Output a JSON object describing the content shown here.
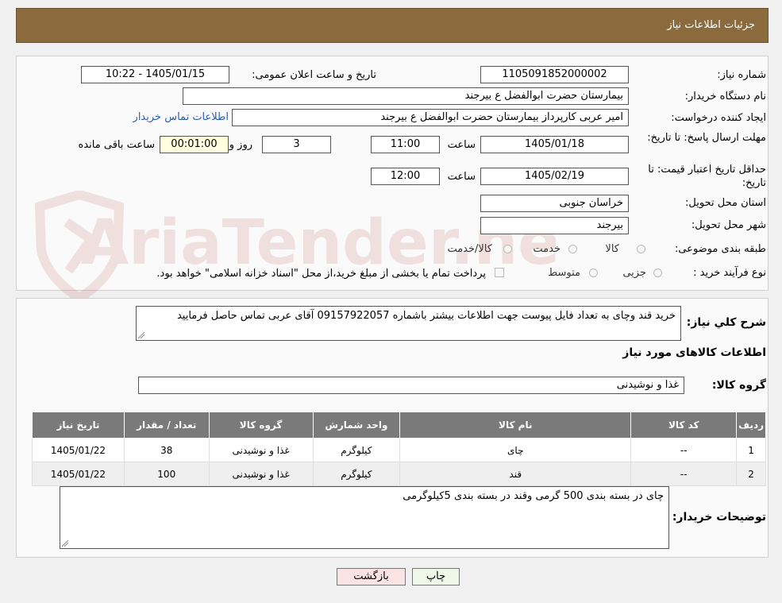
{
  "header": {
    "title": "جزئیات اطلاعات نیاز"
  },
  "form": {
    "need_number_label": "شماره نیاز:",
    "need_number": "1105091852000002",
    "announce_label": "تاریخ و ساعت اعلان عمومی:",
    "announce_value": "1405/01/15 - 10:22",
    "buyer_org_label": "نام دستگاه خریدار:",
    "buyer_org": "بیمارستان حضرت ابوالفضل  ع  بیرجند",
    "creator_label": "ایجاد کننده درخواست:",
    "creator": "امیر عربی کارپرداز بیمارستان حضرت ابوالفضل  ع  بیرجند",
    "contact_link": "اطلاعات تماس خریدار",
    "deadline_label": "مهلت ارسال پاسخ: تا تاریخ:",
    "deadline_date": "1405/01/18",
    "time_label": "ساعت",
    "deadline_time": "11:00",
    "days_value": "3",
    "days_label": "روز و",
    "remaining_time": "00:01:00",
    "remaining_label": "ساعت باقی مانده",
    "validity_label": "حداقل تاریخ اعتبار قیمت: تا تاریخ:",
    "validity_date": "1405/02/19",
    "validity_time": "12:00",
    "province_label": "استان محل تحویل:",
    "province": "خراسان جنوبی",
    "city_label": "شهر محل تحویل:",
    "city": "بیرجند",
    "category_label": "طبقه بندی موضوعی:",
    "category_options": [
      "کالا",
      "خدمت",
      "کالا/خدمت"
    ],
    "process_label": "نوع فرآیند خرید :",
    "process_options": [
      "جزیی",
      "متوسط"
    ],
    "payment_note": "پرداخت تمام یا بخشی از مبلغ خرید،از محل \"اسناد خزانه اسلامی\" خواهد بود."
  },
  "summary": {
    "description_label": "شرح كلي نياز:",
    "description": "خرید قند وچای به تعداد فایل پیوست جهت اطلاعات بیشتر باشماره 09157922057 آقای عربی تماس حاصل فرمایید",
    "items_title": "اطلاعات کالاهای مورد نیاز",
    "group_label": "گروه کالا:",
    "group_value": "غذا و نوشیدنی"
  },
  "table": {
    "headers": [
      "ردیف",
      "کد کالا",
      "نام کالا",
      "واحد شمارش",
      "گروه کالا",
      "تعداد / مقدار",
      "تاریخ نیاز"
    ],
    "rows": [
      [
        "1",
        "--",
        "چای",
        "کیلوگرم",
        "غذا و نوشیدنی",
        "38",
        "1405/01/22"
      ],
      [
        "2",
        "--",
        "قند",
        "کیلوگرم",
        "غذا و نوشیدنی",
        "100",
        "1405/01/22"
      ]
    ]
  },
  "notes": {
    "label": "توضیحات خریدار:",
    "text": "چای در بسته بندی 500 گرمی وقند در بسته بندی 5کیلوگرمی"
  },
  "buttons": {
    "print": "چاپ",
    "back": "بازگشت"
  },
  "watermark": {
    "text": "AriaTender.neT"
  },
  "colors": {
    "header_bg": "#8b6a3d",
    "table_header": "#7a7a7a",
    "link": "#2a5db0",
    "back_button": "#fbe3e3",
    "print_button": "#eef7e8"
  }
}
